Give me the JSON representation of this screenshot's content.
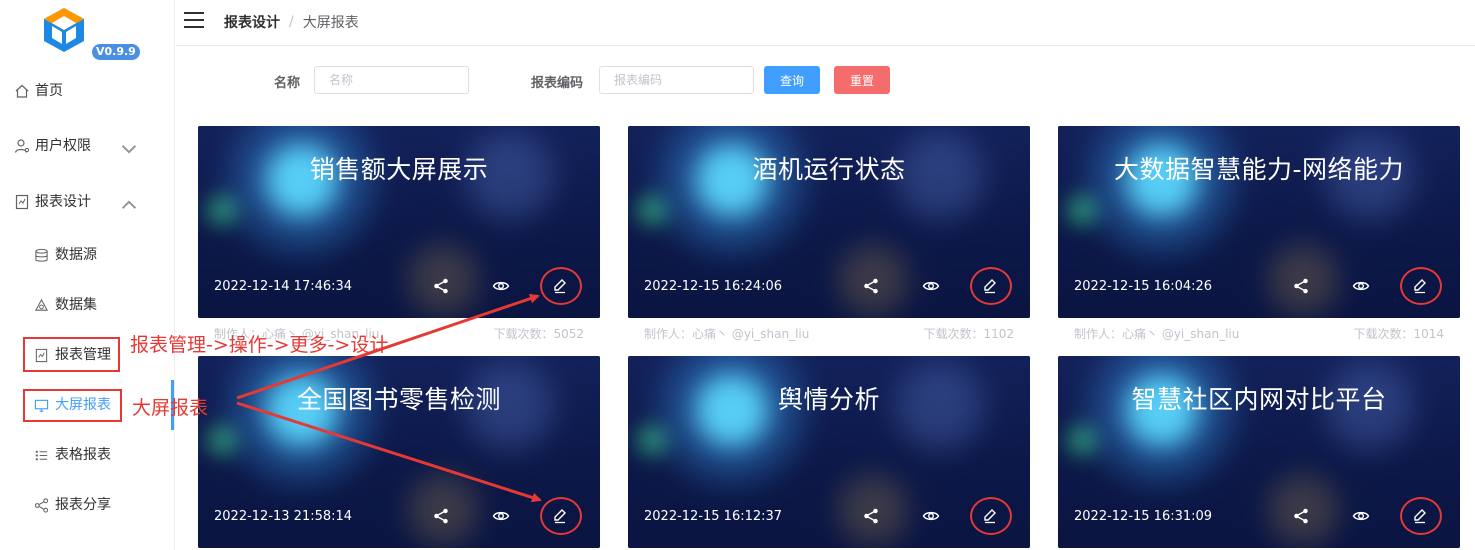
{
  "app": {
    "version": "V0.9.9"
  },
  "sidebar": {
    "items": [
      {
        "label": "首页",
        "icon": "home-icon"
      },
      {
        "label": "用户权限",
        "icon": "user-icon"
      },
      {
        "label": "报表设计",
        "icon": "report-design-icon"
      }
    ],
    "subitems": [
      {
        "label": "数据源",
        "icon": "database-icon"
      },
      {
        "label": "数据集",
        "icon": "dataset-icon"
      },
      {
        "label": "报表管理",
        "icon": "report-manage-icon"
      },
      {
        "label": "大屏报表",
        "icon": "monitor-icon"
      },
      {
        "label": "表格报表",
        "icon": "list-icon"
      },
      {
        "label": "报表分享",
        "icon": "share-icon"
      }
    ]
  },
  "header": {
    "breadcrumb": [
      "报表设计",
      "大屏报表"
    ]
  },
  "search": {
    "name_label": "名称",
    "name_placeholder": "名称",
    "code_label": "报表编码",
    "code_placeholder": "报表编码",
    "query_label": "查询",
    "reset_label": "重置"
  },
  "cards": [
    {
      "title": "销售额大屏展示",
      "time": "2022-12-14 17:46:34",
      "author": "制作人：心痛丶  @yi_shan_liu",
      "downloads": "下载次数：5052"
    },
    {
      "title": "酒机运行状态",
      "time": "2022-12-15 16:24:06",
      "author": "制作人：心痛丶  @yi_shan_liu",
      "downloads": "下载次数：1102"
    },
    {
      "title": "大数据智慧能力-网络能力",
      "time": "2022-12-15 16:04:26",
      "author": "制作人：心痛丶  @yi_shan_liu",
      "downloads": "下载次数：1014"
    },
    {
      "title": "全国图书零售检测",
      "time": "2022-12-13 21:58:14"
    },
    {
      "title": "舆情分析",
      "time": "2022-12-15 16:12:37"
    },
    {
      "title": "智慧社区内网对比平台",
      "time": "2022-12-15 16:31:09"
    }
  ],
  "annotations": {
    "path_note": "报表管理->操作->更多->设计",
    "menu_note": "大屏报表"
  },
  "colors": {
    "accent": "#409eff",
    "danger": "#f56c6c",
    "annotation_red": "#e53935",
    "card_bg": "#0b1642"
  }
}
